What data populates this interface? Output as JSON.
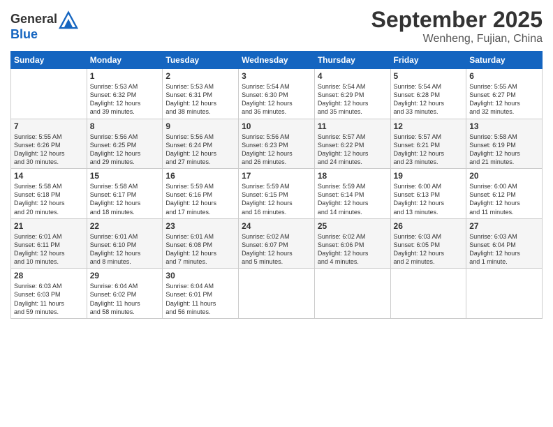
{
  "header": {
    "logo_line1": "General",
    "logo_line2": "Blue",
    "month": "September 2025",
    "location": "Wenheng, Fujian, China"
  },
  "weekdays": [
    "Sunday",
    "Monday",
    "Tuesday",
    "Wednesday",
    "Thursday",
    "Friday",
    "Saturday"
  ],
  "weeks": [
    [
      {
        "day": "",
        "info": ""
      },
      {
        "day": "1",
        "info": "Sunrise: 5:53 AM\nSunset: 6:32 PM\nDaylight: 12 hours\nand 39 minutes."
      },
      {
        "day": "2",
        "info": "Sunrise: 5:53 AM\nSunset: 6:31 PM\nDaylight: 12 hours\nand 38 minutes."
      },
      {
        "day": "3",
        "info": "Sunrise: 5:54 AM\nSunset: 6:30 PM\nDaylight: 12 hours\nand 36 minutes."
      },
      {
        "day": "4",
        "info": "Sunrise: 5:54 AM\nSunset: 6:29 PM\nDaylight: 12 hours\nand 35 minutes."
      },
      {
        "day": "5",
        "info": "Sunrise: 5:54 AM\nSunset: 6:28 PM\nDaylight: 12 hours\nand 33 minutes."
      },
      {
        "day": "6",
        "info": "Sunrise: 5:55 AM\nSunset: 6:27 PM\nDaylight: 12 hours\nand 32 minutes."
      }
    ],
    [
      {
        "day": "7",
        "info": "Sunrise: 5:55 AM\nSunset: 6:26 PM\nDaylight: 12 hours\nand 30 minutes."
      },
      {
        "day": "8",
        "info": "Sunrise: 5:56 AM\nSunset: 6:25 PM\nDaylight: 12 hours\nand 29 minutes."
      },
      {
        "day": "9",
        "info": "Sunrise: 5:56 AM\nSunset: 6:24 PM\nDaylight: 12 hours\nand 27 minutes."
      },
      {
        "day": "10",
        "info": "Sunrise: 5:56 AM\nSunset: 6:23 PM\nDaylight: 12 hours\nand 26 minutes."
      },
      {
        "day": "11",
        "info": "Sunrise: 5:57 AM\nSunset: 6:22 PM\nDaylight: 12 hours\nand 24 minutes."
      },
      {
        "day": "12",
        "info": "Sunrise: 5:57 AM\nSunset: 6:21 PM\nDaylight: 12 hours\nand 23 minutes."
      },
      {
        "day": "13",
        "info": "Sunrise: 5:58 AM\nSunset: 6:19 PM\nDaylight: 12 hours\nand 21 minutes."
      }
    ],
    [
      {
        "day": "14",
        "info": "Sunrise: 5:58 AM\nSunset: 6:18 PM\nDaylight: 12 hours\nand 20 minutes."
      },
      {
        "day": "15",
        "info": "Sunrise: 5:58 AM\nSunset: 6:17 PM\nDaylight: 12 hours\nand 18 minutes."
      },
      {
        "day": "16",
        "info": "Sunrise: 5:59 AM\nSunset: 6:16 PM\nDaylight: 12 hours\nand 17 minutes."
      },
      {
        "day": "17",
        "info": "Sunrise: 5:59 AM\nSunset: 6:15 PM\nDaylight: 12 hours\nand 16 minutes."
      },
      {
        "day": "18",
        "info": "Sunrise: 5:59 AM\nSunset: 6:14 PM\nDaylight: 12 hours\nand 14 minutes."
      },
      {
        "day": "19",
        "info": "Sunrise: 6:00 AM\nSunset: 6:13 PM\nDaylight: 12 hours\nand 13 minutes."
      },
      {
        "day": "20",
        "info": "Sunrise: 6:00 AM\nSunset: 6:12 PM\nDaylight: 12 hours\nand 11 minutes."
      }
    ],
    [
      {
        "day": "21",
        "info": "Sunrise: 6:01 AM\nSunset: 6:11 PM\nDaylight: 12 hours\nand 10 minutes."
      },
      {
        "day": "22",
        "info": "Sunrise: 6:01 AM\nSunset: 6:10 PM\nDaylight: 12 hours\nand 8 minutes."
      },
      {
        "day": "23",
        "info": "Sunrise: 6:01 AM\nSunset: 6:08 PM\nDaylight: 12 hours\nand 7 minutes."
      },
      {
        "day": "24",
        "info": "Sunrise: 6:02 AM\nSunset: 6:07 PM\nDaylight: 12 hours\nand 5 minutes."
      },
      {
        "day": "25",
        "info": "Sunrise: 6:02 AM\nSunset: 6:06 PM\nDaylight: 12 hours\nand 4 minutes."
      },
      {
        "day": "26",
        "info": "Sunrise: 6:03 AM\nSunset: 6:05 PM\nDaylight: 12 hours\nand 2 minutes."
      },
      {
        "day": "27",
        "info": "Sunrise: 6:03 AM\nSunset: 6:04 PM\nDaylight: 12 hours\nand 1 minute."
      }
    ],
    [
      {
        "day": "28",
        "info": "Sunrise: 6:03 AM\nSunset: 6:03 PM\nDaylight: 11 hours\nand 59 minutes."
      },
      {
        "day": "29",
        "info": "Sunrise: 6:04 AM\nSunset: 6:02 PM\nDaylight: 11 hours\nand 58 minutes."
      },
      {
        "day": "30",
        "info": "Sunrise: 6:04 AM\nSunset: 6:01 PM\nDaylight: 11 hours\nand 56 minutes."
      },
      {
        "day": "",
        "info": ""
      },
      {
        "day": "",
        "info": ""
      },
      {
        "day": "",
        "info": ""
      },
      {
        "day": "",
        "info": ""
      }
    ]
  ]
}
